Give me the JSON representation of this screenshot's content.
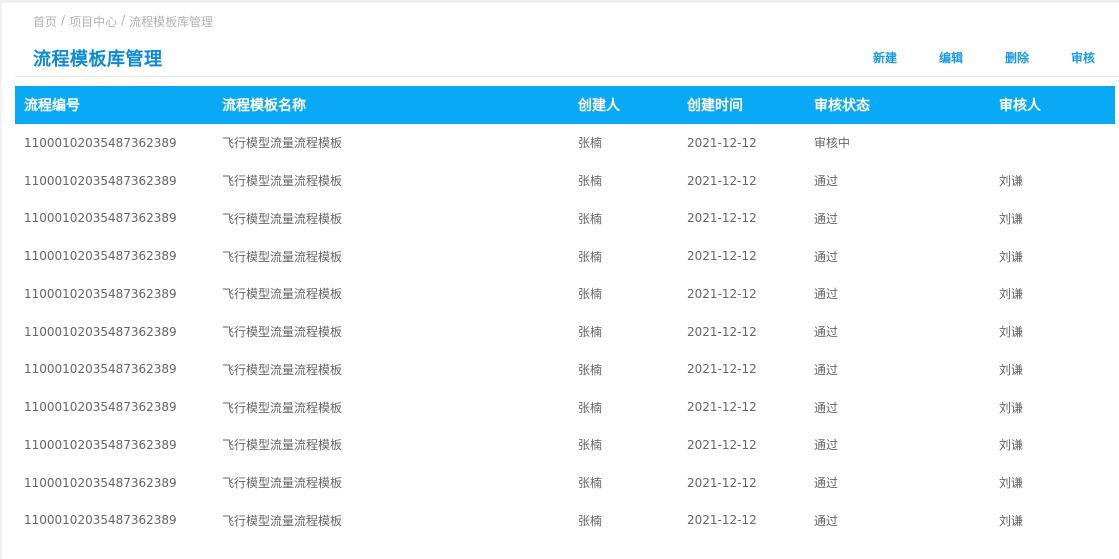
{
  "breadcrumb": {
    "home": "首页",
    "sep1": "/",
    "project": "项目中心",
    "sep2": "/",
    "current": "流程模板库管理"
  },
  "page_title": "流程模板库管理",
  "toolbar": {
    "new": "新建",
    "edit": "编辑",
    "delete": "删除",
    "review": "审核"
  },
  "table": {
    "headers": [
      "流程编号",
      "流程模板名称",
      "创建人",
      "创建时间",
      "审核状态",
      "审核人"
    ],
    "rows": [
      [
        "11000102035487362389",
        "飞行模型流量流程模板",
        "张楠",
        "2021-12-12",
        "审核中",
        ""
      ],
      [
        "11000102035487362389",
        "飞行模型流量流程模板",
        "张楠",
        "2021-12-12",
        "通过",
        "刘谦"
      ],
      [
        "11000102035487362389",
        "飞行模型流量流程模板",
        "张楠",
        "2021-12-12",
        "通过",
        "刘谦"
      ],
      [
        "11000102035487362389",
        "飞行模型流量流程模板",
        "张楠",
        "2021-12-12",
        "通过",
        "刘谦"
      ],
      [
        "11000102035487362389",
        "飞行模型流量流程模板",
        "张楠",
        "2021-12-12",
        "通过",
        "刘谦"
      ],
      [
        "11000102035487362389",
        "飞行模型流量流程模板",
        "张楠",
        "2021-12-12",
        "通过",
        "刘谦"
      ],
      [
        "11000102035487362389",
        "飞行模型流量流程模板",
        "张楠",
        "2021-12-12",
        "通过",
        "刘谦"
      ],
      [
        "11000102035487362389",
        "飞行模型流量流程模板",
        "张楠",
        "2021-12-12",
        "通过",
        "刘谦"
      ],
      [
        "11000102035487362389",
        "飞行模型流量流程模板",
        "张楠",
        "2021-12-12",
        "通过",
        "刘谦"
      ],
      [
        "11000102035487362389",
        "飞行模型流量流程模板",
        "张楠",
        "2021-12-12",
        "通过",
        "刘谦"
      ],
      [
        "11000102035487362389",
        "飞行模型流量流程模板",
        "张楠",
        "2021-12-12",
        "通过",
        "刘谦"
      ]
    ]
  },
  "colors": {
    "accent": "#09a9f5",
    "title": "#0e8ad6",
    "action": "#1f9ae0"
  }
}
